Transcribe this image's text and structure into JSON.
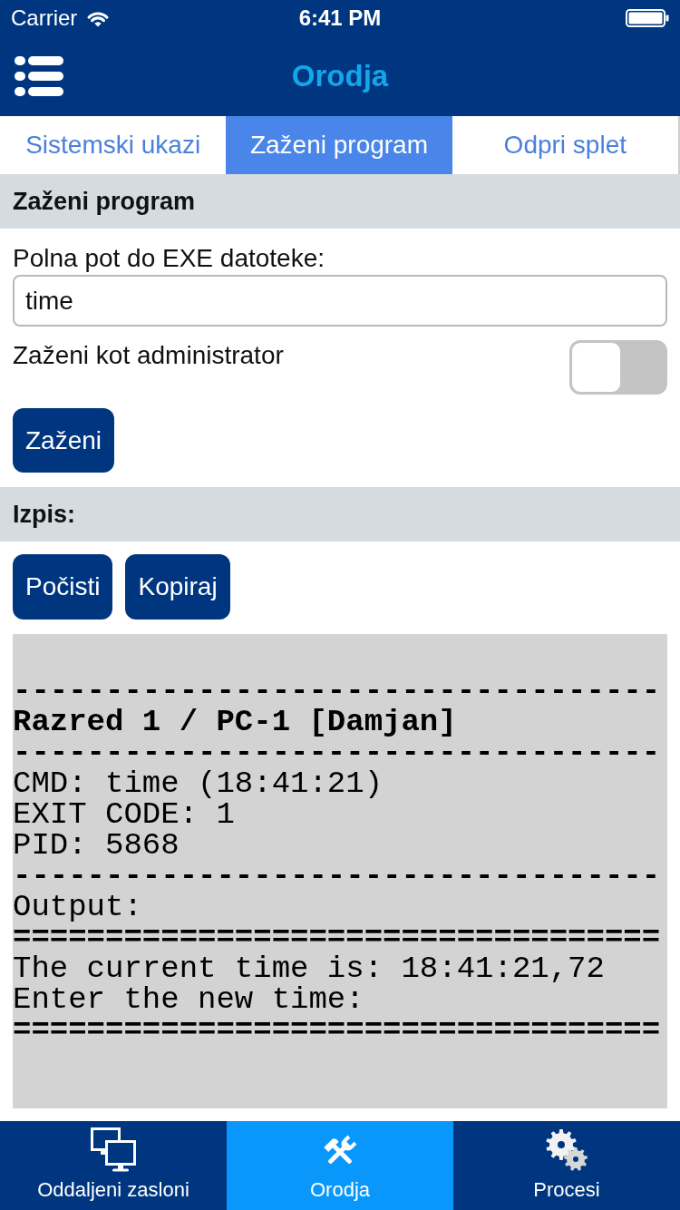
{
  "status_bar": {
    "carrier": "Carrier",
    "time": "6:41 PM"
  },
  "nav_bar": {
    "title": "Orodja"
  },
  "tabs": [
    {
      "label": "Sistemski ukazi",
      "selected": false
    },
    {
      "label": "Zaženi program",
      "selected": true
    },
    {
      "label": "Odpri splet",
      "selected": false
    }
  ],
  "run_section": {
    "title": "Zaženi program",
    "path_label": "Polna pot do EXE datoteke:",
    "path_value": "time",
    "admin_toggle": {
      "label": "Zaženi kot administrator",
      "on": false
    },
    "run_button": "Zaženi"
  },
  "output_section": {
    "title": "Izpis:",
    "buttons": [
      "Počisti",
      "Kopiraj"
    ],
    "console_lines": [
      {
        "kind": "rule",
        "text": "-----------------------------------"
      },
      {
        "kind": "heading",
        "text": "Razred 1 / PC-1 [Damjan]"
      },
      {
        "kind": "rule",
        "text": "-----------------------------------"
      },
      {
        "kind": "text",
        "text": "CMD: time (18:41:21)"
      },
      {
        "kind": "text",
        "text": "EXIT CODE: 1"
      },
      {
        "kind": "text",
        "text": "PID: 5868"
      },
      {
        "kind": "rule",
        "text": "-----------------------------------"
      },
      {
        "kind": "text",
        "text": "Output:"
      },
      {
        "kind": "rule",
        "text": "==================================="
      },
      {
        "kind": "text",
        "text": "The current time is: 18:41:21,72"
      },
      {
        "kind": "text",
        "text": "Enter the new time:"
      },
      {
        "kind": "rule",
        "text": "==================================="
      }
    ]
  },
  "bottom_tabs": [
    {
      "label": "Oddaljeni zasloni",
      "kind": "screens",
      "selected": false
    },
    {
      "label": "Orodja",
      "kind": "tools",
      "selected": true
    },
    {
      "label": "Procesi",
      "kind": "processes",
      "selected": false
    }
  ]
}
